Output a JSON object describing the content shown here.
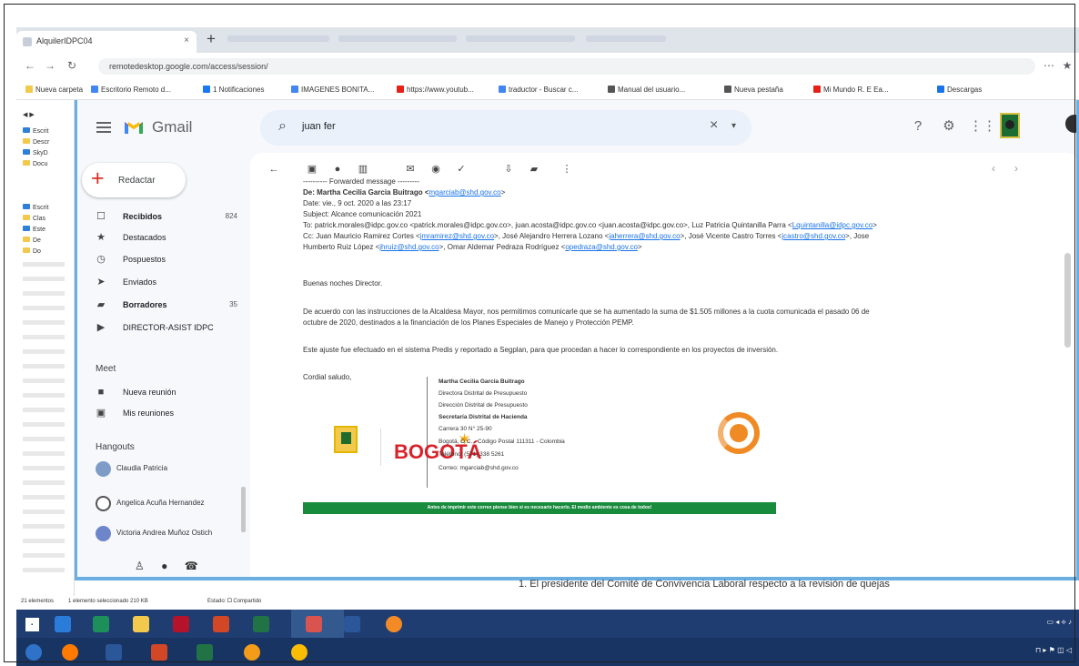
{
  "browser": {
    "tab_title": "AlquilerIDPC04",
    "tab_close": "×",
    "new_tab": "+",
    "url": "remotedesktop.google.com/access/session/",
    "bookmarks": [
      "Nueva carpeta",
      "Escritorio Remoto d...",
      "1 Notificaciones",
      "IMAGENES BONITA...",
      "https://www.youtub...",
      "traductor - Buscar c...",
      "Manual del usuario...",
      "Nueva pestaña",
      "Mi Mundo R. E Ea...",
      "Descargas"
    ]
  },
  "gmail": {
    "app_name": "Gmail",
    "search": {
      "value": "juan fer",
      "clear_icon": "close-icon",
      "options_icon": "chevron-down-icon"
    },
    "compose_label": "Redactar",
    "nav": [
      {
        "label": "Recibidos",
        "count": "824",
        "bold": true
      },
      {
        "label": "Destacados",
        "count": ""
      },
      {
        "label": "Pospuestos",
        "count": ""
      },
      {
        "label": "Enviados",
        "count": ""
      },
      {
        "label": "Borradores",
        "count": "35",
        "bold": true
      },
      {
        "label": "DIRECTOR-ASIST IDPC",
        "count": ""
      }
    ],
    "meet": {
      "title": "Meet",
      "items": [
        "Nueva reunión",
        "Mis reuniones"
      ]
    },
    "hangouts": {
      "title": "Hangouts",
      "contacts": [
        "Claudia Patricia",
        "Angelica Acuña Hernandez",
        "Victoria Andrea Muñoz Ostich"
      ]
    }
  },
  "email": {
    "forwarded": "---------- Forwarded message ---------",
    "de": "De: Martha Cecilia Garcia Buitrago <",
    "date": "Date: vie., 9 oct. 2020 a las 23:17",
    "subject": "Subject: Alcance comunicación 2021",
    "to": "To: patrick.morales@idpc.gov.co <patrick.morales@idpc.gov.co>, juan.acosta@idpc.gov.co <juan.acosta@idpc.gov.co>, Luz Patricia Quintanilla Parra <",
    "cc": "Cc: Juan Mauricio Ramirez Cortes <",
    "cc2": "Humberto Ruiz López <",
    "greeting": "Buenas noches Director.",
    "body1": "De acuerdo con las instrucciones de la Alcaldesa Mayor, nos permitimos comunicarle que se ha aumentado la suma de $1.505 millones a la cuota comunicada el pasado 06 de",
    "body2": "octubre de 2020, destinados a la financiación de los Planes Especiales de Manejo y Protección PEMP.",
    "body3": "Este ajuste fue efectuado en el sistema Predis y reportado a Segplan, para que procedan a hacer lo correspondiente en los proyectos de inversión.",
    "closing": "Cordial saludo,",
    "signature": [
      "Martha Cecilia Garcia Buitrago",
      "Directora Distrital de Presupuesto",
      "Dirección Distrital de Presupuesto",
      "Secretaría Distrital de Hacienda",
      "Carrera 30 N° 25-90",
      "Bogotá, D.C. - Código Postal 111311 - Colombia",
      "Teléfono: (571) 338 5261",
      "Correo: mgarciab@shd.gov.co"
    ],
    "bogota_logo": "BOGOTÁ",
    "footer": "Antes de imprimir este correo piense bien si es necesario hacerlo. El medio ambiente es cosa de todos!"
  },
  "desktop": {
    "word_line": "1.   El presidente del Comité de Convivencia Laboral respecto a la revisión de quejas",
    "status": {
      "items": "21 elementos",
      "selected": "1 elemento seleccionado  210 KB",
      "state": "Estado: 🞐 Compartido"
    }
  },
  "icons": {
    "search": "search-icon",
    "help": "question-icon",
    "settings": "gear-icon",
    "apps": "apps-icon",
    "back": "arrow-left-icon"
  }
}
